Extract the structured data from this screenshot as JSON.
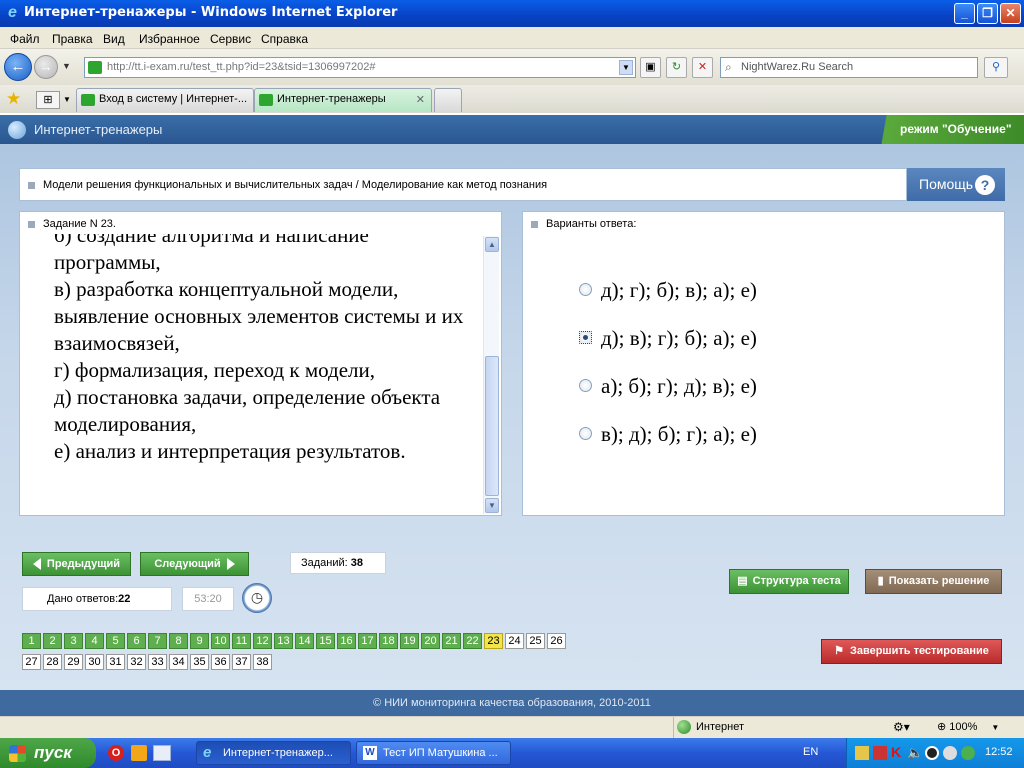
{
  "window": {
    "title": "Интернет-тренажеры - Windows Internet Explorer"
  },
  "menu": [
    "Файл",
    "Правка",
    "Вид",
    "Избранное",
    "Сервис",
    "Справка"
  ],
  "address": {
    "url": "http://tt.i-exam.ru/test_tt.php?id=23&tsid=1306997202#"
  },
  "search": {
    "placeholder": "NightWarez.Ru Search"
  },
  "tabs": [
    {
      "label": "Вход в систему | Интернет-..."
    },
    {
      "label": "Интернет-тренажеры"
    }
  ],
  "app": {
    "name": "Интернет-тренажеры",
    "mode": "режим \"Обучение\""
  },
  "topic": "Модели решения функциональных и вычислительных задач / Моделирование как метод познания",
  "help": {
    "label": "Помощь",
    "icon": "?"
  },
  "task": {
    "header": "Задание N 23.",
    "text": "б) создание алгоритма и написание программы,\nв) разработка концептуальной модели, выявление основных элементов системы и их взаимосвязей,\nг) формализация, переход к модели,\nд) постановка задачи, определение объекта моделирования,\nе) анализ и интерпретация результатов."
  },
  "answers": {
    "header": "Варианты ответа:",
    "options": [
      {
        "label": "д); г); б); в); а); е)",
        "selected": false
      },
      {
        "label": "д); в); г); б); а); е)",
        "selected": true
      },
      {
        "label": "а); б); г); д); в); е)",
        "selected": false
      },
      {
        "label": "в); д); б); г); а); е)",
        "selected": false
      }
    ]
  },
  "nav": {
    "prev": "Предыдущий",
    "next": "Следующий",
    "tasks_label": "Заданий:",
    "tasks_count": "38",
    "answered_label": "Дано ответов:",
    "answered_count": "22",
    "timer": "53:20",
    "structure": "Структура теста",
    "show_solution": "Показать решение",
    "finish": "Завершить тестирование"
  },
  "questions": {
    "items": [
      "1",
      "2",
      "3",
      "4",
      "5",
      "6",
      "7",
      "8",
      "9",
      "10",
      "11",
      "12",
      "13",
      "14",
      "15",
      "16",
      "17",
      "18",
      "19",
      "20",
      "21",
      "22",
      "23",
      "24",
      "25",
      "26",
      "27",
      "28",
      "29",
      "30",
      "31",
      "32",
      "33",
      "34",
      "35",
      "36",
      "37",
      "38"
    ],
    "answered_through": 22,
    "current": 23
  },
  "footer": "© НИИ мониторинга качества образования, 2010-2011",
  "status": {
    "zone": "Интернет",
    "zoom": "100%"
  },
  "taskbar": {
    "start": "пуск",
    "items": [
      "Интернет-тренажер...",
      "Тест ИП Матушкина ..."
    ],
    "lang": "EN",
    "clock": "12:52"
  }
}
